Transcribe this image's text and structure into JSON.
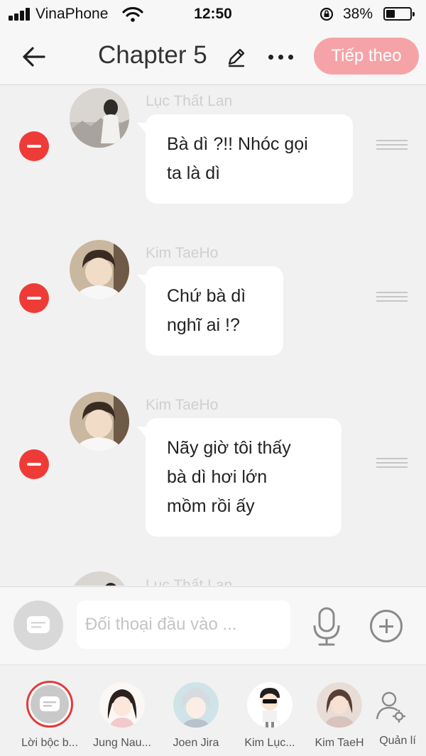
{
  "status_bar": {
    "carrier": "VinaPhone",
    "time": "12:50",
    "battery_percent": "38%",
    "battery_level": 0.38
  },
  "header": {
    "title": "Chapter 5",
    "next_button": "Tiếp theo",
    "back_icon": "arrow-left-icon",
    "edit_icon": "pencil-icon",
    "more_icon": "more-horizontal-icon"
  },
  "messages": [
    {
      "speaker": "Lục Thất Lan",
      "lines": [
        "Bà dì ?!! Nhóc gọi",
        "ta là dì"
      ]
    },
    {
      "speaker": "Kim TaeHo",
      "lines": [
        "Chứ bà dì",
        "nghĩ ai !?"
      ]
    },
    {
      "speaker": "Kim TaeHo",
      "lines": [
        "Nãy giờ tôi thấy",
        "bà dì hơi lớn",
        "mồm rồi ấy"
      ]
    },
    {
      "speaker": "Lục Thất Lan",
      "lines": []
    }
  ],
  "composer": {
    "placeholder": "Đối thoại đầu vào ...",
    "mic_icon": "microphone-icon",
    "add_icon": "plus-circle-icon"
  },
  "characters": [
    {
      "name": "Lời bộc b..."
    },
    {
      "name": "Jung Nau..."
    },
    {
      "name": "Joen Jira"
    },
    {
      "name": "Kim Lục..."
    },
    {
      "name": "Kim TaeH"
    }
  ],
  "manage_label": "Quản lí",
  "colors": {
    "accent_pink": "#f6a3a8",
    "delete_red": "#ef3b37",
    "bubble_bg": "#ffffff",
    "chat_bg": "#f2f1f2"
  }
}
